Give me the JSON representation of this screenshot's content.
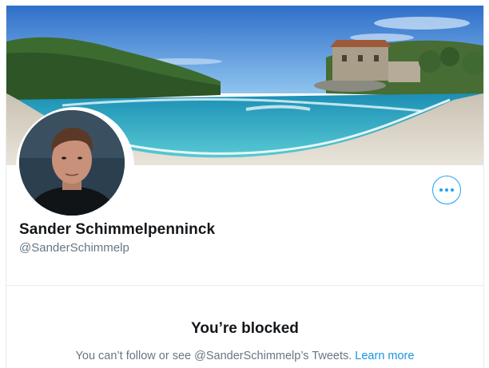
{
  "profile": {
    "display_name": "Sander Schimmelpenninck",
    "handle": "@SanderSchimmelp"
  },
  "header": {
    "more_icon": "more-horizontal-icon",
    "accent_color": "#1da1f2"
  },
  "blocked": {
    "title": "You’re blocked",
    "message": "You can’t follow or see @SanderSchimmelp’s Tweets.",
    "link_label": "Learn more"
  },
  "colors": {
    "text_primary": "#14171a",
    "text_secondary": "#657786",
    "link": "#1b95e0",
    "divider": "#e6ecf0"
  }
}
